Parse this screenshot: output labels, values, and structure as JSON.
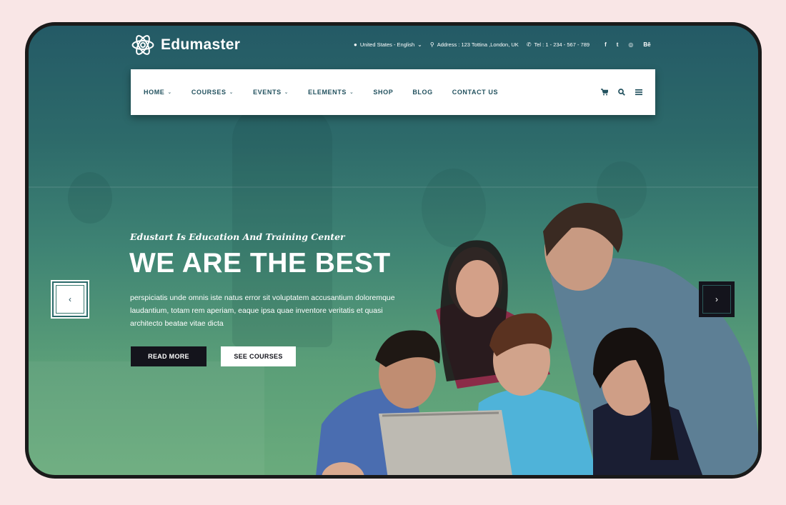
{
  "brand": {
    "name": "Edumaster",
    "icon": "atom-icon"
  },
  "topbar": {
    "language": "United States - English",
    "address": "Address : 123 Tottina ,London, UK",
    "phone": "Tel : 1 - 234 - 567 - 789",
    "social": [
      {
        "name": "facebook",
        "glyph": "f"
      },
      {
        "name": "twitter",
        "glyph": "t"
      },
      {
        "name": "instagram",
        "glyph": "◎"
      },
      {
        "name": "behance",
        "glyph": "Bē"
      }
    ]
  },
  "nav": {
    "items": [
      {
        "label": "HOME",
        "dropdown": true
      },
      {
        "label": "COURSES",
        "dropdown": true
      },
      {
        "label": "EVENTS",
        "dropdown": true
      },
      {
        "label": "ELEMENTS",
        "dropdown": true
      },
      {
        "label": "SHOP",
        "dropdown": false
      },
      {
        "label": "BLOG",
        "dropdown": false
      },
      {
        "label": "CONTACT US",
        "dropdown": false
      }
    ],
    "tools": [
      "cart-icon",
      "search-icon",
      "menu-icon"
    ]
  },
  "hero": {
    "subtitle": "Edustart Is Education And Training Center",
    "title": "WE ARE THE BEST",
    "description": "perspiciatis unde omnis iste natus error sit voluptatem accusantium doloremque laudantium, totam rem aperiam, eaque ipsa quae inventore veritatis et quasi architecto beatae vitae dicta",
    "buttons": {
      "primary": "READ MORE",
      "secondary": "SEE COURSES"
    },
    "prev_glyph": "‹",
    "next_glyph": "›"
  },
  "colors": {
    "page_bg": "#f9e6e6",
    "frame_border": "#1a1a1a",
    "hero_top": "#245a66",
    "hero_bottom": "#6aab7c",
    "nav_text": "#23525f",
    "dark_button": "#14141c"
  }
}
